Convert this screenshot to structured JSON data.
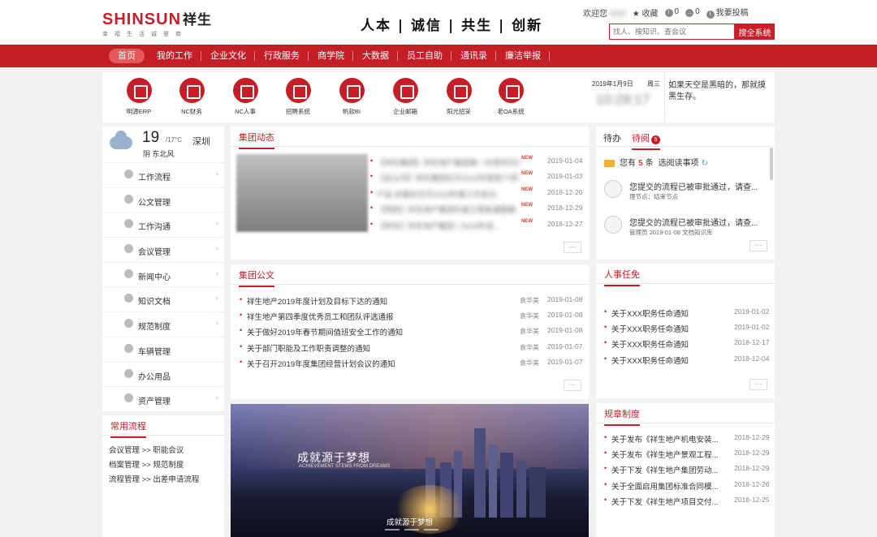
{
  "brand": {
    "logo_latin": "SHINSUN",
    "logo_cn": "祥生",
    "logo_tagline": "幸福生活诚誉商"
  },
  "slogan": "人本 | 诚信 | 共生 | 创新",
  "topbar": {
    "welcome": "欢迎您",
    "user": "XXX",
    "favorite": "收藏",
    "count_a": "0",
    "count_b": "0",
    "report": "我要投稿"
  },
  "search": {
    "placeholder": "找人、搜知识、查会议",
    "button": "搜全系统"
  },
  "nav": [
    "首页",
    "我的工作",
    "企业文化",
    "行政服务",
    "商学院",
    "大数据",
    "员工自助",
    "通讯录",
    "廉洁举报"
  ],
  "apps": [
    "明源ERP",
    "NC财务",
    "NC人事",
    "招聘系统",
    "帆软BI",
    "企业邮箱",
    "阳光招采",
    "老OA系统"
  ],
  "datebox": {
    "date": "2019年1月9日",
    "weekday": "周三",
    "time": "10:28:17"
  },
  "quote": "如果天空是黑暗的，那就摸黑生存。",
  "weather": {
    "temp": "19",
    "range": "/17°C",
    "city": "深圳",
    "desc": "阴 东北风"
  },
  "menu": [
    "工作流程",
    "公文管理",
    "工作沟通",
    "会议管理",
    "新闻中心",
    "知识文档",
    "规范制度",
    "车辆管理",
    "办公用品",
    "资产管理"
  ],
  "common": {
    "title": "常用流程",
    "items": [
      "会议管理 >> 职能会议",
      "档案管理 >> 规范制度",
      "流程管理 >> 出差申请流程"
    ]
  },
  "news": {
    "title": "集团动态",
    "items": [
      {
        "text": "【祥生集团】祥生地产集团第一次党员代表考察和...",
        "badge": "NEW",
        "date": "2019-01-04"
      },
      {
        "text": "【总公司】祥生集团召开2019年度首个项目苍...",
        "badge": "NEW",
        "date": "2019-01-03"
      },
      {
        "text": "产品 总裁办召开2018年度工作会议...",
        "badge": "NEW",
        "date": "2018-12-20"
      },
      {
        "text": "【项目】祥生地产集团年度工程来诸暨春...",
        "badge": "NEW",
        "date": "2018-12-29"
      },
      {
        "text": "【祥生】祥生地产集团 • 2018年说...",
        "badge": "NEW",
        "date": "2018-12-27"
      }
    ],
    "more": "···"
  },
  "docs": {
    "title": "集团公文",
    "items": [
      {
        "text": "祥生地产2019年度计划及目标下达的通知",
        "author": "袁华美",
        "date": "2019-01-08"
      },
      {
        "text": "祥生地产第四季度优秀员工和团队评选通报",
        "author": "袁华美",
        "date": "2019-01-08"
      },
      {
        "text": "关于做好2019年春节期间值班安全工作的通知",
        "author": "袁华美",
        "date": "2019-01-08"
      },
      {
        "text": "关于部门职能及工作职责调整的通知",
        "author": "袁华美",
        "date": "2019-01-07"
      },
      {
        "text": "关于召开2019年度集团经营计划会议的通知",
        "author": "袁华美",
        "date": "2019-01-07"
      }
    ],
    "more": "···"
  },
  "banner": {
    "caption_main": "成就源于梦想",
    "caption_en": "ACHIEVEMENT STEMS FROM DREAMS",
    "caption_bottom": "成就源于梦想"
  },
  "todo": {
    "tab1": "待办",
    "tab2": "待阅",
    "badge": "5",
    "summary_prefix": "您有",
    "summary_count": "5",
    "summary_suffix": "条",
    "summary_link": "选阅读事项",
    "messages": [
      {
        "title": "您提交的流程已被审批通过，请查...",
        "sub": "理节点：结束节点"
      },
      {
        "title": "您提交的流程已被审批通过，请查...",
        "sub": "管理员 2019-01-08 文档知识库"
      }
    ],
    "more": "···"
  },
  "hr": {
    "title": "人事任免",
    "items": [
      {
        "text": "关于XXX职务任命通知",
        "date": "2019-01-02"
      },
      {
        "text": "关于XXX职务任命通知",
        "date": "2019-01-02"
      },
      {
        "text": "关于XXX职务任命通知",
        "date": "2018-12-17"
      },
      {
        "text": "关于XXX职务任命通知",
        "date": "2018-12-04"
      }
    ],
    "more": "···"
  },
  "rules": {
    "title": "规章制度",
    "items": [
      {
        "text": "关于发布《祥生地产机电安装...",
        "date": "2018-12-29"
      },
      {
        "text": "关于发布《祥生地产景观工程...",
        "date": "2018-12-29"
      },
      {
        "text": "关于下发《祥生地产集团劳动...",
        "date": "2018-12-29"
      },
      {
        "text": "关于全面启用集团标准合同模...",
        "date": "2018-12-26"
      },
      {
        "text": "关于下发《祥生地产项目交付...",
        "date": "2018-12-25"
      }
    ]
  }
}
